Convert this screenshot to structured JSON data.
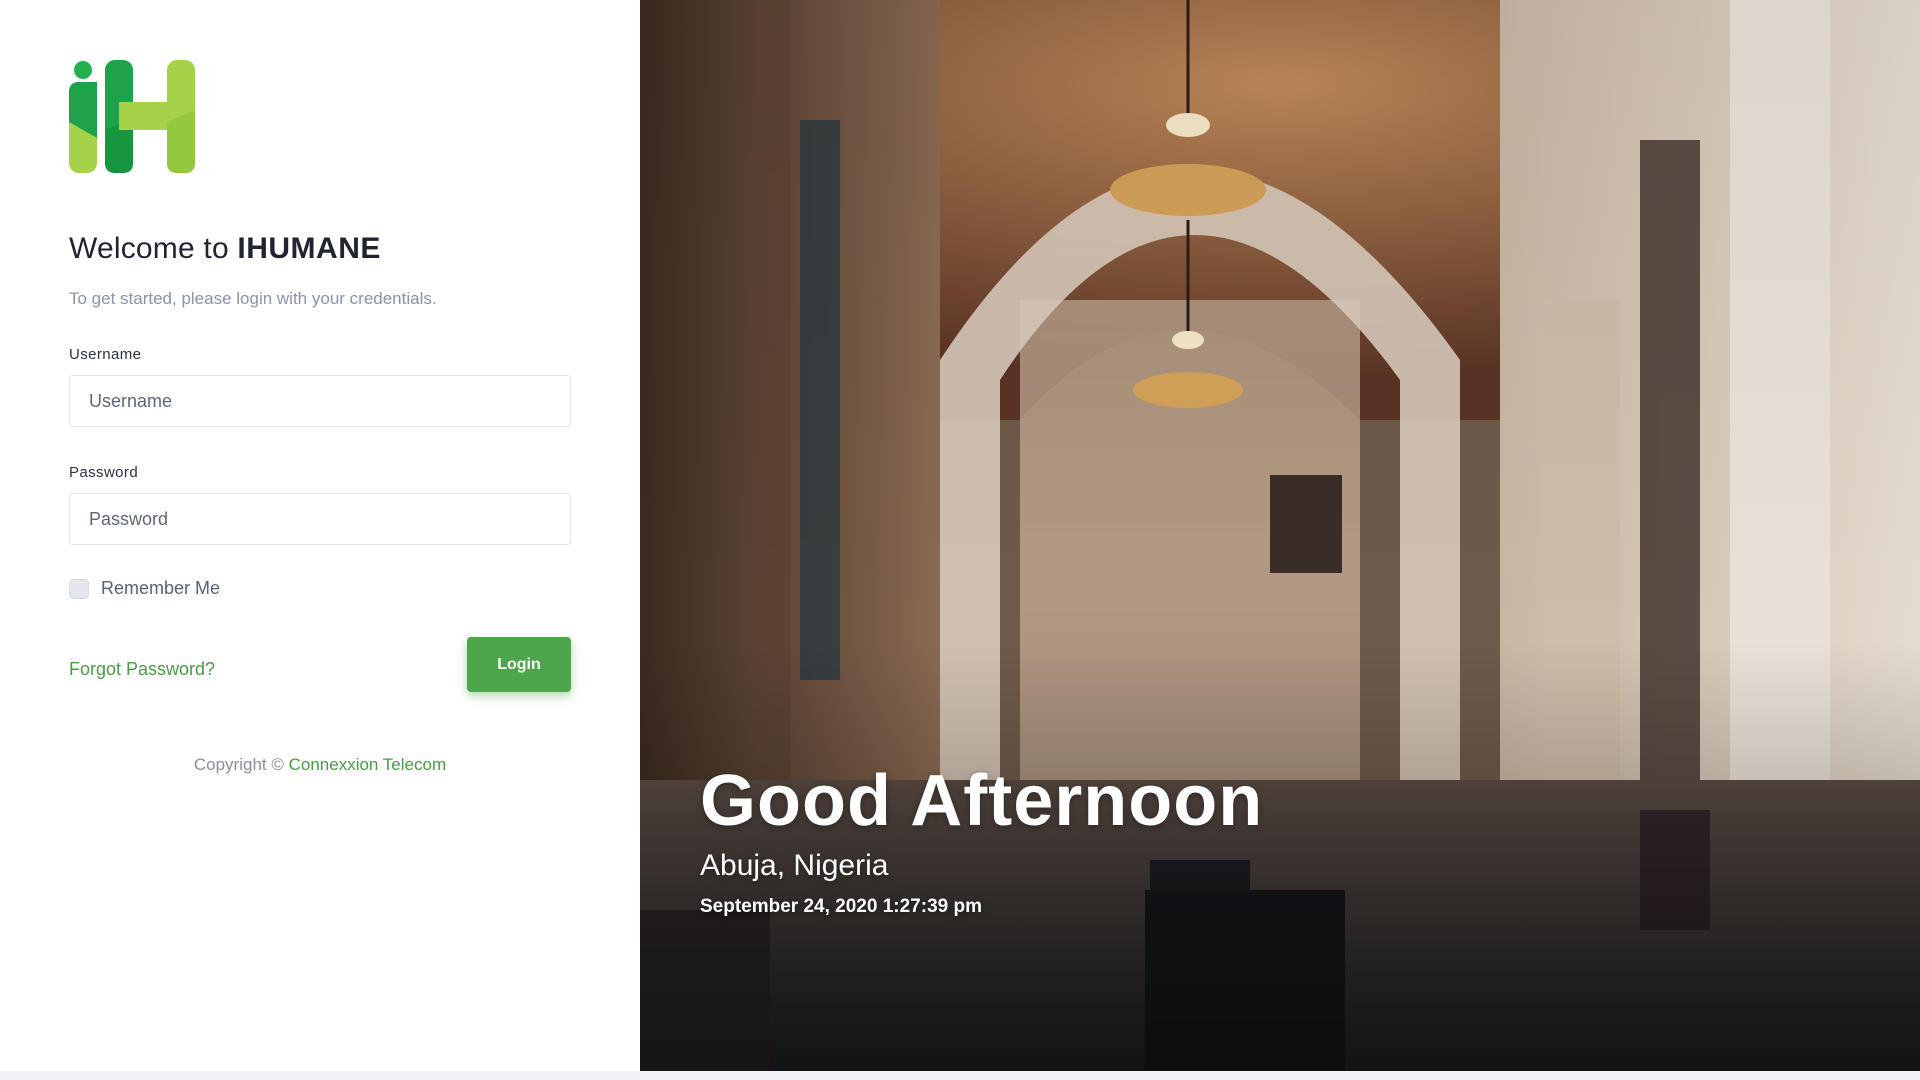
{
  "brand": {
    "logo_icon": "ihumane-logo",
    "primary_color": "#4ea64b",
    "logo_dark_green": "#16a34a",
    "logo_light_green": "#a3d34b"
  },
  "login": {
    "welcome_prefix": "Welcome to ",
    "app_name": "IHUMANE",
    "subtitle": "To get started, please login with your credentials.",
    "username_label": "Username",
    "username_placeholder": "Username",
    "username_value": "",
    "password_label": "Password",
    "password_placeholder": "Password",
    "password_value": "",
    "remember_label": "Remember Me",
    "remember_checked": false,
    "forgot_label": "Forgot Password?",
    "login_label": "Login"
  },
  "footer": {
    "copyright_prefix": "Copyright © ",
    "company": "Connexxion Telecom"
  },
  "hero": {
    "greeting": "Good Afternoon",
    "location": "Abuja, Nigeria",
    "datetime": "September 24, 2020 1:27:39 pm"
  }
}
